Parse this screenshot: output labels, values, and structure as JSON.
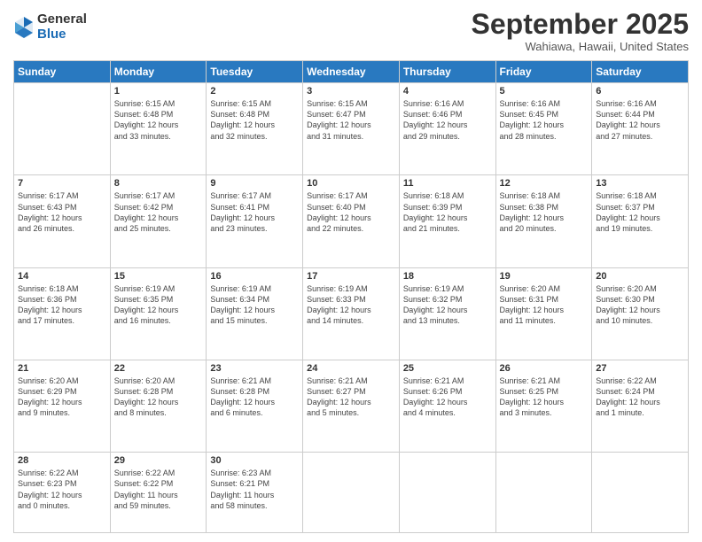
{
  "logo": {
    "general": "General",
    "blue": "Blue"
  },
  "title": "September 2025",
  "location": "Wahiawa, Hawaii, United States",
  "headers": [
    "Sunday",
    "Monday",
    "Tuesday",
    "Wednesday",
    "Thursday",
    "Friday",
    "Saturday"
  ],
  "weeks": [
    [
      {
        "day": "",
        "info": ""
      },
      {
        "day": "1",
        "info": "Sunrise: 6:15 AM\nSunset: 6:48 PM\nDaylight: 12 hours\nand 33 minutes."
      },
      {
        "day": "2",
        "info": "Sunrise: 6:15 AM\nSunset: 6:48 PM\nDaylight: 12 hours\nand 32 minutes."
      },
      {
        "day": "3",
        "info": "Sunrise: 6:15 AM\nSunset: 6:47 PM\nDaylight: 12 hours\nand 31 minutes."
      },
      {
        "day": "4",
        "info": "Sunrise: 6:16 AM\nSunset: 6:46 PM\nDaylight: 12 hours\nand 29 minutes."
      },
      {
        "day": "5",
        "info": "Sunrise: 6:16 AM\nSunset: 6:45 PM\nDaylight: 12 hours\nand 28 minutes."
      },
      {
        "day": "6",
        "info": "Sunrise: 6:16 AM\nSunset: 6:44 PM\nDaylight: 12 hours\nand 27 minutes."
      }
    ],
    [
      {
        "day": "7",
        "info": "Sunrise: 6:17 AM\nSunset: 6:43 PM\nDaylight: 12 hours\nand 26 minutes."
      },
      {
        "day": "8",
        "info": "Sunrise: 6:17 AM\nSunset: 6:42 PM\nDaylight: 12 hours\nand 25 minutes."
      },
      {
        "day": "9",
        "info": "Sunrise: 6:17 AM\nSunset: 6:41 PM\nDaylight: 12 hours\nand 23 minutes."
      },
      {
        "day": "10",
        "info": "Sunrise: 6:17 AM\nSunset: 6:40 PM\nDaylight: 12 hours\nand 22 minutes."
      },
      {
        "day": "11",
        "info": "Sunrise: 6:18 AM\nSunset: 6:39 PM\nDaylight: 12 hours\nand 21 minutes."
      },
      {
        "day": "12",
        "info": "Sunrise: 6:18 AM\nSunset: 6:38 PM\nDaylight: 12 hours\nand 20 minutes."
      },
      {
        "day": "13",
        "info": "Sunrise: 6:18 AM\nSunset: 6:37 PM\nDaylight: 12 hours\nand 19 minutes."
      }
    ],
    [
      {
        "day": "14",
        "info": "Sunrise: 6:18 AM\nSunset: 6:36 PM\nDaylight: 12 hours\nand 17 minutes."
      },
      {
        "day": "15",
        "info": "Sunrise: 6:19 AM\nSunset: 6:35 PM\nDaylight: 12 hours\nand 16 minutes."
      },
      {
        "day": "16",
        "info": "Sunrise: 6:19 AM\nSunset: 6:34 PM\nDaylight: 12 hours\nand 15 minutes."
      },
      {
        "day": "17",
        "info": "Sunrise: 6:19 AM\nSunset: 6:33 PM\nDaylight: 12 hours\nand 14 minutes."
      },
      {
        "day": "18",
        "info": "Sunrise: 6:19 AM\nSunset: 6:32 PM\nDaylight: 12 hours\nand 13 minutes."
      },
      {
        "day": "19",
        "info": "Sunrise: 6:20 AM\nSunset: 6:31 PM\nDaylight: 12 hours\nand 11 minutes."
      },
      {
        "day": "20",
        "info": "Sunrise: 6:20 AM\nSunset: 6:30 PM\nDaylight: 12 hours\nand 10 minutes."
      }
    ],
    [
      {
        "day": "21",
        "info": "Sunrise: 6:20 AM\nSunset: 6:29 PM\nDaylight: 12 hours\nand 9 minutes."
      },
      {
        "day": "22",
        "info": "Sunrise: 6:20 AM\nSunset: 6:28 PM\nDaylight: 12 hours\nand 8 minutes."
      },
      {
        "day": "23",
        "info": "Sunrise: 6:21 AM\nSunset: 6:28 PM\nDaylight: 12 hours\nand 6 minutes."
      },
      {
        "day": "24",
        "info": "Sunrise: 6:21 AM\nSunset: 6:27 PM\nDaylight: 12 hours\nand 5 minutes."
      },
      {
        "day": "25",
        "info": "Sunrise: 6:21 AM\nSunset: 6:26 PM\nDaylight: 12 hours\nand 4 minutes."
      },
      {
        "day": "26",
        "info": "Sunrise: 6:21 AM\nSunset: 6:25 PM\nDaylight: 12 hours\nand 3 minutes."
      },
      {
        "day": "27",
        "info": "Sunrise: 6:22 AM\nSunset: 6:24 PM\nDaylight: 12 hours\nand 1 minute."
      }
    ],
    [
      {
        "day": "28",
        "info": "Sunrise: 6:22 AM\nSunset: 6:23 PM\nDaylight: 12 hours\nand 0 minutes."
      },
      {
        "day": "29",
        "info": "Sunrise: 6:22 AM\nSunset: 6:22 PM\nDaylight: 11 hours\nand 59 minutes."
      },
      {
        "day": "30",
        "info": "Sunrise: 6:23 AM\nSunset: 6:21 PM\nDaylight: 11 hours\nand 58 minutes."
      },
      {
        "day": "",
        "info": ""
      },
      {
        "day": "",
        "info": ""
      },
      {
        "day": "",
        "info": ""
      },
      {
        "day": "",
        "info": ""
      }
    ]
  ]
}
